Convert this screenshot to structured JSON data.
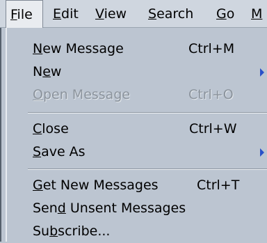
{
  "menubar": {
    "items": [
      {
        "label": "File",
        "mnemonic": "F"
      },
      {
        "label": "Edit",
        "mnemonic": "E"
      },
      {
        "label": "View",
        "mnemonic": "V"
      },
      {
        "label": "Search",
        "mnemonic": "S"
      },
      {
        "label": "Go",
        "mnemonic": "G"
      },
      {
        "label": "M",
        "mnemonic": "M"
      }
    ],
    "active": "File"
  },
  "file_menu": {
    "items": [
      {
        "label": "New Message",
        "mnemonic": "N",
        "accel": "Ctrl+M",
        "enabled": true,
        "submenu": false
      },
      {
        "label": "New",
        "mnemonic": "e",
        "accel": "",
        "enabled": true,
        "submenu": true
      },
      {
        "label": "Open Message",
        "mnemonic": "O",
        "accel": "Ctrl+O",
        "enabled": false,
        "submenu": false
      },
      {
        "label": "Close",
        "mnemonic": "C",
        "accel": "Ctrl+W",
        "enabled": true,
        "submenu": false
      },
      {
        "label": "Save As",
        "mnemonic": "S",
        "accel": "",
        "enabled": true,
        "submenu": true
      },
      {
        "label": "Get New Messages",
        "mnemonic": "G",
        "accel": "Ctrl+T",
        "enabled": true,
        "submenu": false
      },
      {
        "label": "Send Unsent Messages",
        "mnemonic": "d",
        "accel": "",
        "enabled": true,
        "submenu": false
      },
      {
        "label": "Subscribe...",
        "mnemonic": "b",
        "accel": "",
        "enabled": true,
        "submenu": false
      }
    ]
  },
  "colors": {
    "menu_bg": "#bcc5d1",
    "menubar_bg": "#cfd6df",
    "disabled_text": "#8c949d",
    "submenu_arrow": "#2950c8"
  }
}
